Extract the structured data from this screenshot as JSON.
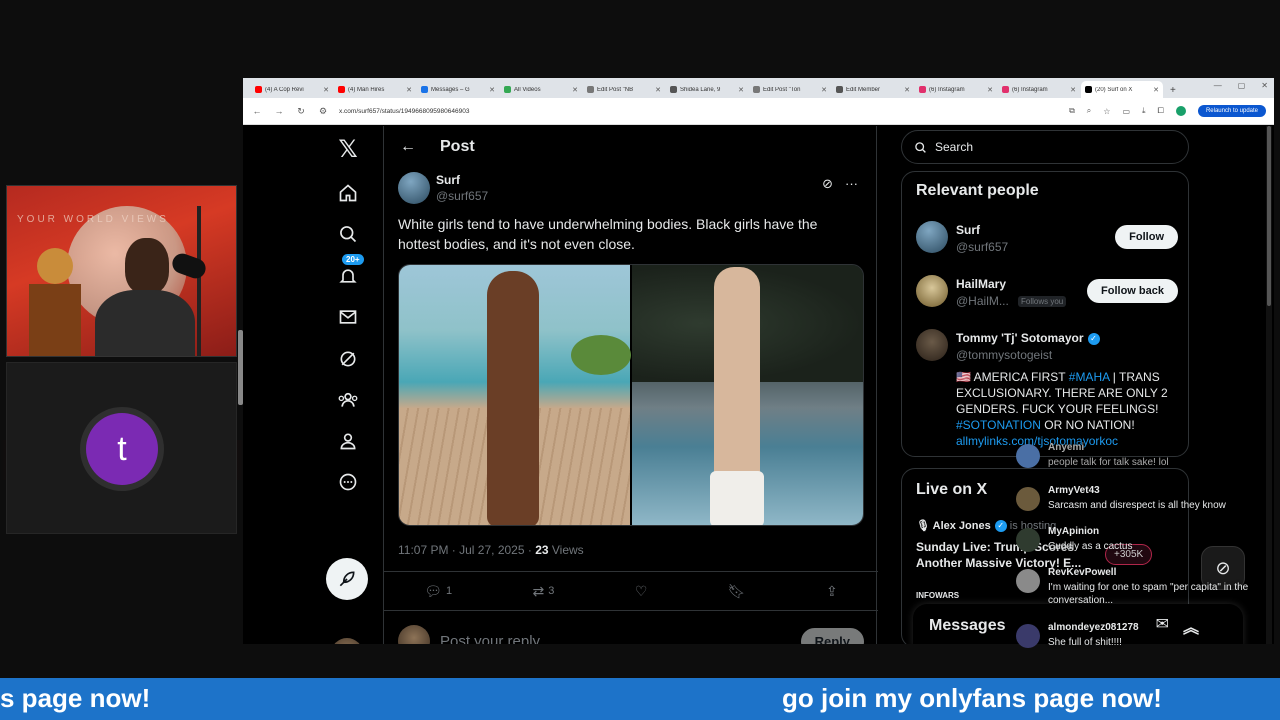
{
  "browser": {
    "tabs": [
      {
        "label": "(4) A Cop Revi",
        "color": "#ff0000"
      },
      {
        "label": "(4) Man Hires",
        "color": "#ff0000"
      },
      {
        "label": "Messages – G",
        "color": "#1a73e8"
      },
      {
        "label": "All Videos",
        "color": "#34a853"
      },
      {
        "label": "Edit Post \"NB",
        "color": "#777777"
      },
      {
        "label": "Shidea Lane, 9",
        "color": "#555555"
      },
      {
        "label": "Edit Post \"Ton",
        "color": "#777777"
      },
      {
        "label": "Edit Member",
        "color": "#555555"
      },
      {
        "label": "(6) Instagram",
        "color": "#e1306c"
      },
      {
        "label": "(6) Instagram",
        "color": "#e1306c"
      },
      {
        "label": "(20) Surf on X",
        "color": "#000000"
      }
    ],
    "url": "x.com/surf657/status/1949668095980646903",
    "relaunch_label": "Relaunch to update"
  },
  "nav": {
    "notif_badge": "20+"
  },
  "post": {
    "header_title": "Post",
    "author_name": "Surf",
    "author_handle": "@surf657",
    "text": "White girls tend to have underwhelming bodies. Black girls have the hottest bodies, and it's not even close.",
    "time": "11:07 PM · Jul 27, 2025 · ",
    "views_count": "23",
    "views_label": " Views",
    "replies": "1",
    "reposts": "3",
    "reply_placeholder": "Post your reply",
    "reply_button": "Reply"
  },
  "sidebar": {
    "search_placeholder": "Search",
    "relevant_title": "Relevant people",
    "people": [
      {
        "name": "Surf",
        "handle": "@surf657",
        "button": "Follow"
      },
      {
        "name": "HailMary",
        "handle": "@HailM...",
        "follows_you": "Follows you",
        "button": "Follow back"
      },
      {
        "name": "Tommy 'Tj' Sotomayor",
        "handle": "@tommysotogeist",
        "bio_flag": "🇺🇸",
        "bio_a": " AMERICA FIRST ",
        "bio_tag1": "#MAHA",
        "bio_b": " | TRANS EXCLUSIONARY. THERE ARE ONLY 2 GENDERS. FUCK YOUR FEELINGS! ",
        "bio_tag2": "#SOTONATION",
        "bio_c": " OR NO NATION! ",
        "bio_link": "allmylinks.com/tjsotomayorkoc"
      }
    ],
    "live_title": "Live on X",
    "live_host": "Alex Jones",
    "live_host_suffix": "is hosting",
    "live_text": "Sunday Live: Trump Scores Another Massive Victory! E...",
    "live_sub": "INFOWARS",
    "live_count": "+305K",
    "messages_label": "Messages"
  },
  "chat": [
    {
      "user": "Anyemi",
      "text": "people talk for talk sake! lol",
      "color": "#4a6fa5"
    },
    {
      "user": "ArmyVet43",
      "text": "Sarcasm and disrespect is all they know",
      "color": "#6b5a3c"
    },
    {
      "user": "MyApinion",
      "text": "Cuddly as a cactus",
      "color": "#2f3b2f"
    },
    {
      "user": "RevKevPowell",
      "text": "I'm waiting for one to spam \"per capita\" in the conversation...",
      "color": "#8a8a8a"
    },
    {
      "user": "almondeyez081278",
      "text": "She full of shit!!!!",
      "color": "#3a3a6a"
    }
  ],
  "webcam": {
    "banner": "YOUR WORLD VIEWS"
  },
  "stream_user_initial": "t",
  "ticker": {
    "left": "s page now!",
    "right": "go join my onlyfans page now!"
  }
}
